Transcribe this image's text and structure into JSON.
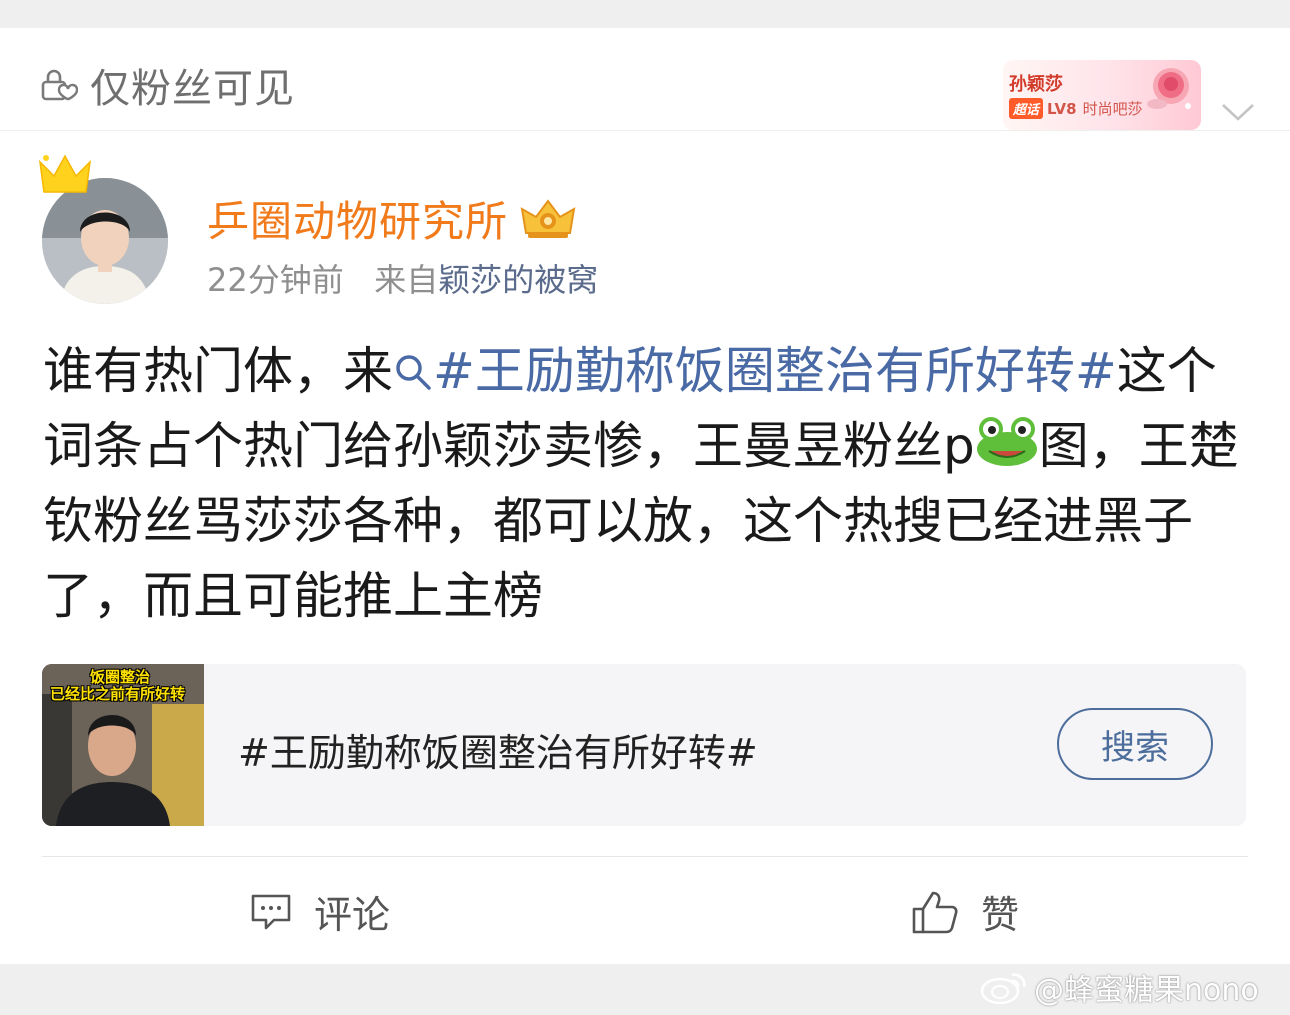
{
  "header": {
    "visibility_text": "仅粉丝可见",
    "badge": {
      "name": "孙颖莎",
      "tag": "超话",
      "level": "LV8",
      "title": "时尚吧莎"
    }
  },
  "post": {
    "username": "乒圈动物研究所",
    "time": "22分钟前",
    "from_prefix": "来自",
    "from_source": "颖莎的被窝",
    "text_part1": "谁有热门体，来",
    "topic": "#王励勤称饭圈整治有所好转#",
    "text_part2": "这个词条占个热门给孙颖莎卖惨，王曼昱粉丝p",
    "text_part3": "图，王楚钦粉丝骂莎莎各种，都可以放，这个热搜已经进黑子了，而且可能推上主榜"
  },
  "topic_card": {
    "thumb_caption_line1": "饭圈整治",
    "thumb_caption_line2": "已经比之前有所好转",
    "title": "#王励勤称饭圈整治有所好转#",
    "search_label": "搜索"
  },
  "actions": {
    "comment_label": "评论",
    "like_label": "赞"
  },
  "watermark": "@蜂蜜糖果nono",
  "colors": {
    "username": "#f17a1b",
    "link": "#4a6aa5",
    "button": "#4d6e9c"
  }
}
